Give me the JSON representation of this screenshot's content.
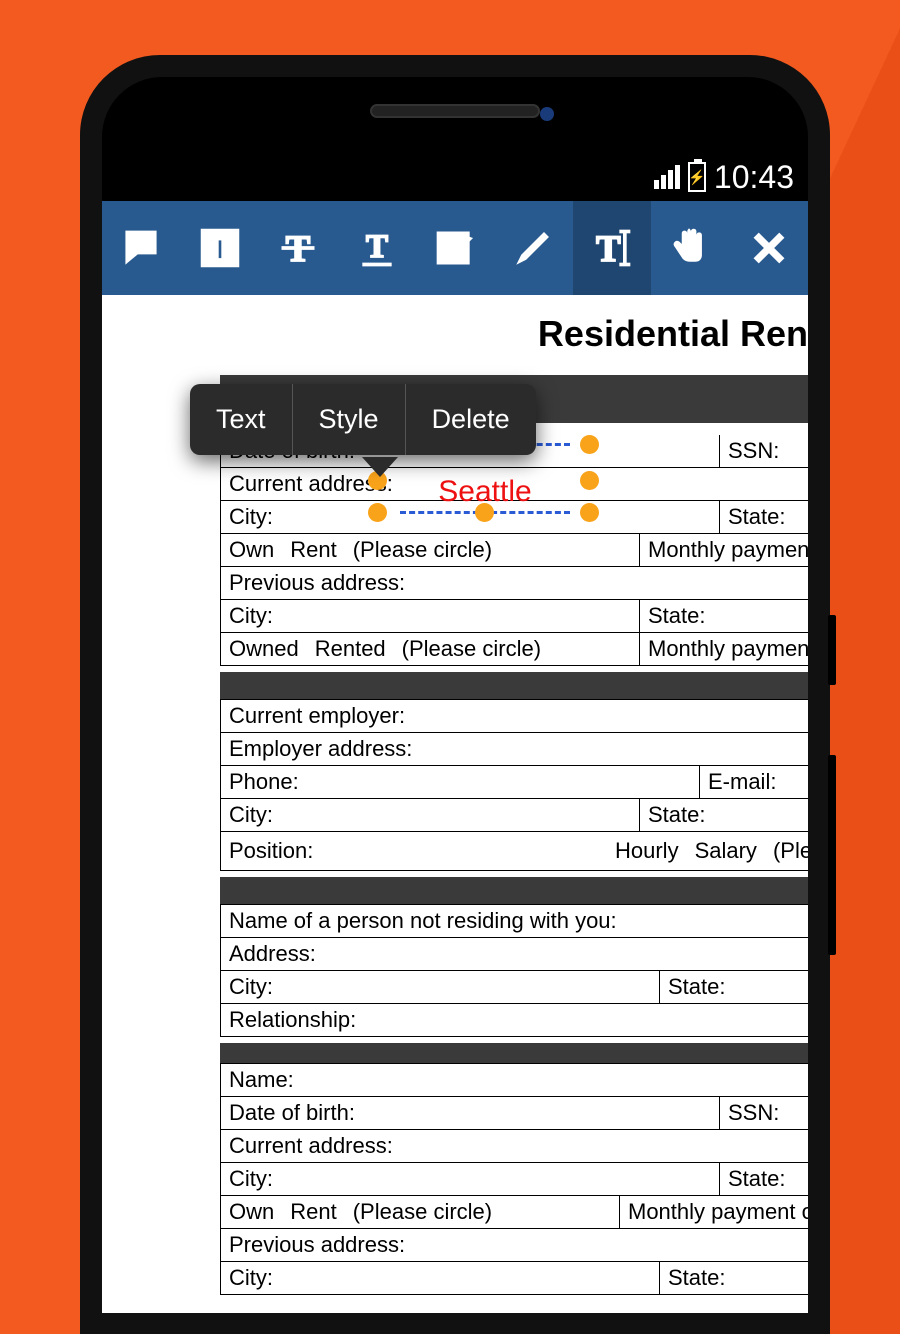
{
  "status": {
    "time": "10:43"
  },
  "context_menu": {
    "text": "Text",
    "style": "Style",
    "delete": "Delete"
  },
  "doc": {
    "title": "Residential Ren",
    "annotation_value": "Seattle",
    "fields": {
      "dob": "Date of birth:",
      "ssn": "SSN:",
      "curr_addr": "Current address:",
      "city": "City:",
      "state": "State:",
      "own": "Own",
      "rent": "Rent",
      "please_circle": "(Please circle)",
      "monthly": "Monthly payment or rent:",
      "prev_addr": "Previous address:",
      "owned": "Owned",
      "rented": "Rented",
      "curr_employer": "Current employer:",
      "employer_addr": "Employer address:",
      "phone": "Phone:",
      "email": "E-mail:",
      "position": "Position:",
      "hourly": "Hourly",
      "salary": "Salary",
      "please_c_partial": "(Please c",
      "not_residing": "Name of a person not residing with you:",
      "address": "Address:",
      "relationship": "Relationship:",
      "name": "Name:"
    }
  }
}
